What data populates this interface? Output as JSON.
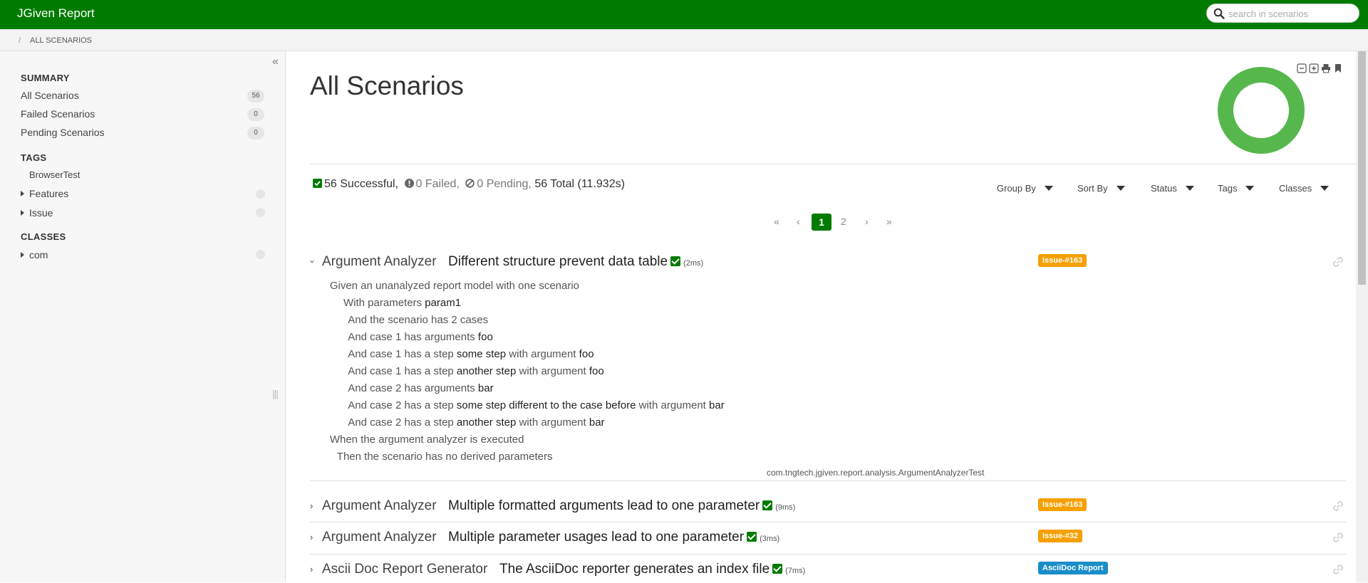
{
  "app": {
    "title": "JGiven Report"
  },
  "search": {
    "placeholder": "search in scenarios"
  },
  "breadcrumb": {
    "separator": "/",
    "current": "ALL SCENARIOS"
  },
  "sidebar": {
    "summary_heading": "SUMMARY",
    "summary_items": [
      {
        "label": "All Scenarios",
        "count": "56"
      },
      {
        "label": "Failed Scenarios",
        "count": "0"
      },
      {
        "label": "Pending Scenarios",
        "count": "0"
      }
    ],
    "tags_heading": "TAGS",
    "tags": {
      "leaf": "BrowserTest",
      "groups": [
        "Features",
        "Issue"
      ]
    },
    "classes_heading": "CLASSES",
    "classes": [
      "com"
    ],
    "collapse_icon": "double-chevron-left-icon",
    "resize_handle": "|||"
  },
  "main": {
    "title": "All Scenarios",
    "status_chart": {
      "type": "donut",
      "successful": 56,
      "failed": 0,
      "pending": 0,
      "color": "#56b74c"
    },
    "stats": {
      "successful": "56 Successful,",
      "failed": "0 Failed,",
      "pending": "0 Pending,",
      "total": "56 Total (11.932s)"
    },
    "filters": [
      "Group By",
      "Sort By",
      "Status",
      "Tags",
      "Classes"
    ],
    "pagination": {
      "first": "«",
      "prev": "‹",
      "pages": [
        "1",
        "2"
      ],
      "active": "1",
      "next": "›",
      "last": "»"
    },
    "scenarios": [
      {
        "class": "Argument Analyzer",
        "title": "Different structure prevent data table",
        "duration": "(2ms)",
        "tag": "Issue-#163",
        "tag_type": "issue",
        "expanded": true,
        "steps": [
          {
            "kw": "Given",
            "parts": [
              [
                "an unanalyzed report model with one scenario",
                false
              ]
            ]
          },
          {
            "kw": "With",
            "parts": [
              [
                "parameters",
                false
              ],
              [
                " param1",
                true
              ]
            ]
          },
          {
            "kw": "And",
            "parts": [
              [
                "the scenario has 2 cases",
                false
              ]
            ]
          },
          {
            "kw": "And",
            "parts": [
              [
                "case 1 has arguments",
                false
              ],
              [
                " foo",
                true
              ]
            ]
          },
          {
            "kw": "And",
            "parts": [
              [
                "case 1 has a step",
                false
              ],
              [
                " some step",
                true
              ],
              [
                " with argument",
                false
              ],
              [
                " foo",
                true
              ]
            ]
          },
          {
            "kw": "And",
            "parts": [
              [
                "case 1 has a step",
                false
              ],
              [
                " another step",
                true
              ],
              [
                " with argument",
                false
              ],
              [
                " foo",
                true
              ]
            ]
          },
          {
            "kw": "And",
            "parts": [
              [
                "case 2 has arguments",
                false
              ],
              [
                " bar",
                true
              ]
            ]
          },
          {
            "kw": "And",
            "parts": [
              [
                "case 2 has a step",
                false
              ],
              [
                " some step different to the case before",
                true
              ],
              [
                " with argument",
                false
              ],
              [
                " bar",
                true
              ]
            ]
          },
          {
            "kw": "And",
            "parts": [
              [
                "case 2 has a step",
                false
              ],
              [
                " another step",
                true
              ],
              [
                " with argument",
                false
              ],
              [
                " bar",
                true
              ]
            ]
          },
          {
            "kw": "When",
            "parts": [
              [
                "the argument analyzer is executed",
                false
              ]
            ]
          },
          {
            "kw": "Then",
            "parts": [
              [
                "the scenario has no derived parameters",
                false
              ]
            ]
          }
        ],
        "test_class": "com.tngtech.jgiven.report.analysis.ArgumentAnalyzerTest"
      },
      {
        "class": "Argument Analyzer",
        "title": "Multiple formatted arguments lead to one parameter",
        "duration": "(9ms)",
        "tag": "Issue-#163",
        "tag_type": "issue",
        "expanded": false
      },
      {
        "class": "Argument Analyzer",
        "title": "Multiple parameter usages lead to one parameter",
        "duration": "(3ms)",
        "tag": "Issue-#32",
        "tag_type": "issue",
        "expanded": false
      },
      {
        "class": "Ascii Doc Report Generator",
        "title": "The AsciiDoc reporter generates an index file",
        "duration": "(7ms)",
        "tag": "AsciiDoc Report",
        "tag_type": "adoc",
        "expanded": false
      }
    ]
  }
}
